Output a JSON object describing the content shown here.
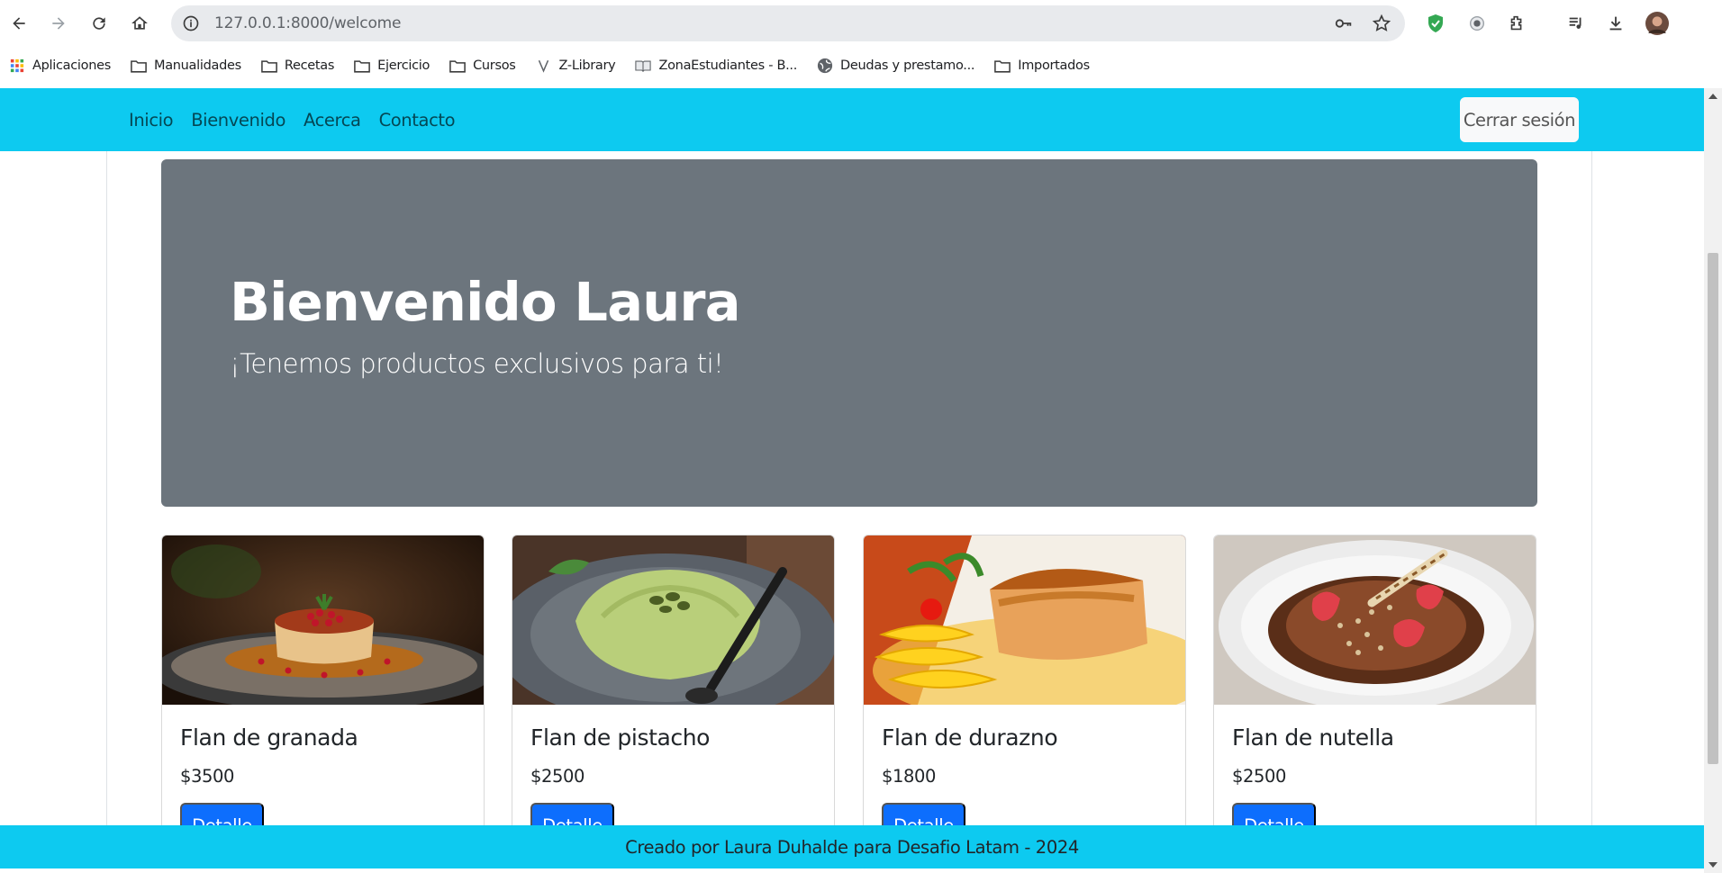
{
  "browser": {
    "url": "127.0.0.1:8000/welcome",
    "bookmarks": [
      {
        "label": "Aplicaciones",
        "icon": "apps-grid-icon"
      },
      {
        "label": "Manualidades",
        "icon": "folder-icon"
      },
      {
        "label": "Recetas",
        "icon": "folder-icon"
      },
      {
        "label": "Ejercicio",
        "icon": "folder-icon"
      },
      {
        "label": "Cursos",
        "icon": "folder-icon"
      },
      {
        "label": "Z-Library",
        "icon": "zlibrary-icon"
      },
      {
        "label": "ZonaEstudiantes - B...",
        "icon": "book-icon"
      },
      {
        "label": "Deudas y prestamo...",
        "icon": "globe-icon"
      },
      {
        "label": "Importados",
        "icon": "folder-icon"
      }
    ]
  },
  "navbar": {
    "links": [
      "Inicio",
      "Bienvenido",
      "Acerca",
      "Contacto"
    ],
    "logout_label": "Cerrar sesión",
    "color": "#0dcaf0"
  },
  "hero": {
    "title": "Bienvenido Laura",
    "subtitle": "¡Tenemos productos exclusivos para ti!",
    "background": "#6c757d"
  },
  "products": [
    {
      "name": "Flan de granada",
      "price": "$3500",
      "button": "Detalle"
    },
    {
      "name": "Flan de pistacho",
      "price": "$2500",
      "button": "Detalle"
    },
    {
      "name": "Flan de durazno",
      "price": "$1800",
      "button": "Detalle"
    },
    {
      "name": "Flan de nutella",
      "price": "$2500",
      "button": "Detalle"
    }
  ],
  "footer": {
    "text": "Creado por Laura Duhalde para Desafio Latam - 2024"
  }
}
